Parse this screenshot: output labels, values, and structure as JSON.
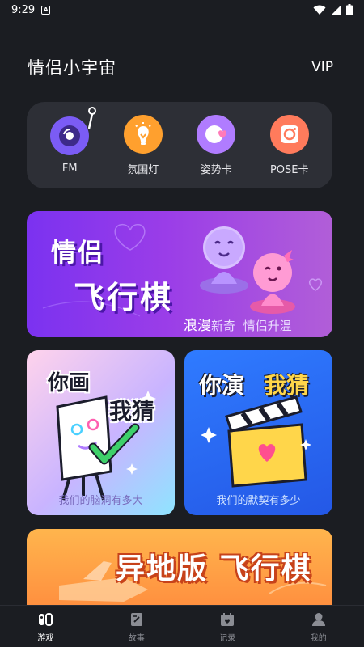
{
  "status_bar": {
    "time": "9:29",
    "sim_badge": "A"
  },
  "header": {
    "title": "情侣小宇宙",
    "vip": "VIP"
  },
  "tools": [
    {
      "label": "FM",
      "icon": "fm-record-icon",
      "color": "#7b5cf5"
    },
    {
      "label": "氛围灯",
      "icon": "lamp-icon",
      "color": "#ffa02e"
    },
    {
      "label": "姿势卡",
      "icon": "heart-card-icon",
      "color": "#b07cff"
    },
    {
      "label": "POSE卡",
      "icon": "camera-icon",
      "color": "#ff7b5c"
    }
  ],
  "banners": {
    "flying_chess": {
      "title_line1": "情侣",
      "title_line2": "飞行棋",
      "subtitle_a": "浪漫",
      "subtitle_b": "新奇",
      "subtitle_c": "情侣升温"
    },
    "draw_guess": {
      "word1": "你画",
      "word2": "我猜",
      "subtitle": "我们的脑洞有多大"
    },
    "act_guess": {
      "word1": "你演",
      "word2": "我猜",
      "subtitle": "我们的默契有多少"
    },
    "remote_chess": {
      "title": "异地版 飞行棋"
    }
  },
  "tab_bar": {
    "items": [
      {
        "label": "游戏",
        "icon": "gamepad-icon",
        "active": true
      },
      {
        "label": "故事",
        "icon": "story-edit-icon",
        "active": false
      },
      {
        "label": "记录",
        "icon": "calendar-heart-icon",
        "active": false
      },
      {
        "label": "我的",
        "icon": "user-icon",
        "active": false
      }
    ]
  }
}
